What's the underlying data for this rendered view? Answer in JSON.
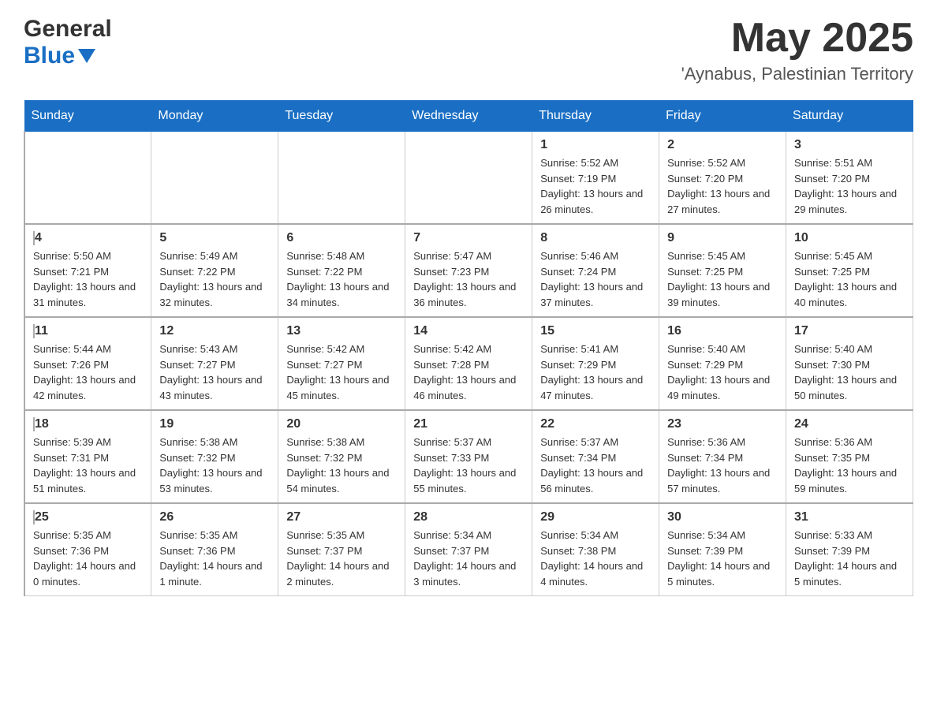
{
  "header": {
    "logo_top": "General",
    "logo_bottom": "Blue",
    "month": "May 2025",
    "location": "'Aynabus, Palestinian Territory"
  },
  "days_of_week": [
    "Sunday",
    "Monday",
    "Tuesday",
    "Wednesday",
    "Thursday",
    "Friday",
    "Saturday"
  ],
  "weeks": [
    [
      {
        "day": "",
        "info": ""
      },
      {
        "day": "",
        "info": ""
      },
      {
        "day": "",
        "info": ""
      },
      {
        "day": "",
        "info": ""
      },
      {
        "day": "1",
        "info": "Sunrise: 5:52 AM\nSunset: 7:19 PM\nDaylight: 13 hours and 26 minutes."
      },
      {
        "day": "2",
        "info": "Sunrise: 5:52 AM\nSunset: 7:20 PM\nDaylight: 13 hours and 27 minutes."
      },
      {
        "day": "3",
        "info": "Sunrise: 5:51 AM\nSunset: 7:20 PM\nDaylight: 13 hours and 29 minutes."
      }
    ],
    [
      {
        "day": "4",
        "info": "Sunrise: 5:50 AM\nSunset: 7:21 PM\nDaylight: 13 hours and 31 minutes."
      },
      {
        "day": "5",
        "info": "Sunrise: 5:49 AM\nSunset: 7:22 PM\nDaylight: 13 hours and 32 minutes."
      },
      {
        "day": "6",
        "info": "Sunrise: 5:48 AM\nSunset: 7:22 PM\nDaylight: 13 hours and 34 minutes."
      },
      {
        "day": "7",
        "info": "Sunrise: 5:47 AM\nSunset: 7:23 PM\nDaylight: 13 hours and 36 minutes."
      },
      {
        "day": "8",
        "info": "Sunrise: 5:46 AM\nSunset: 7:24 PM\nDaylight: 13 hours and 37 minutes."
      },
      {
        "day": "9",
        "info": "Sunrise: 5:45 AM\nSunset: 7:25 PM\nDaylight: 13 hours and 39 minutes."
      },
      {
        "day": "10",
        "info": "Sunrise: 5:45 AM\nSunset: 7:25 PM\nDaylight: 13 hours and 40 minutes."
      }
    ],
    [
      {
        "day": "11",
        "info": "Sunrise: 5:44 AM\nSunset: 7:26 PM\nDaylight: 13 hours and 42 minutes."
      },
      {
        "day": "12",
        "info": "Sunrise: 5:43 AM\nSunset: 7:27 PM\nDaylight: 13 hours and 43 minutes."
      },
      {
        "day": "13",
        "info": "Sunrise: 5:42 AM\nSunset: 7:27 PM\nDaylight: 13 hours and 45 minutes."
      },
      {
        "day": "14",
        "info": "Sunrise: 5:42 AM\nSunset: 7:28 PM\nDaylight: 13 hours and 46 minutes."
      },
      {
        "day": "15",
        "info": "Sunrise: 5:41 AM\nSunset: 7:29 PM\nDaylight: 13 hours and 47 minutes."
      },
      {
        "day": "16",
        "info": "Sunrise: 5:40 AM\nSunset: 7:29 PM\nDaylight: 13 hours and 49 minutes."
      },
      {
        "day": "17",
        "info": "Sunrise: 5:40 AM\nSunset: 7:30 PM\nDaylight: 13 hours and 50 minutes."
      }
    ],
    [
      {
        "day": "18",
        "info": "Sunrise: 5:39 AM\nSunset: 7:31 PM\nDaylight: 13 hours and 51 minutes."
      },
      {
        "day": "19",
        "info": "Sunrise: 5:38 AM\nSunset: 7:32 PM\nDaylight: 13 hours and 53 minutes."
      },
      {
        "day": "20",
        "info": "Sunrise: 5:38 AM\nSunset: 7:32 PM\nDaylight: 13 hours and 54 minutes."
      },
      {
        "day": "21",
        "info": "Sunrise: 5:37 AM\nSunset: 7:33 PM\nDaylight: 13 hours and 55 minutes."
      },
      {
        "day": "22",
        "info": "Sunrise: 5:37 AM\nSunset: 7:34 PM\nDaylight: 13 hours and 56 minutes."
      },
      {
        "day": "23",
        "info": "Sunrise: 5:36 AM\nSunset: 7:34 PM\nDaylight: 13 hours and 57 minutes."
      },
      {
        "day": "24",
        "info": "Sunrise: 5:36 AM\nSunset: 7:35 PM\nDaylight: 13 hours and 59 minutes."
      }
    ],
    [
      {
        "day": "25",
        "info": "Sunrise: 5:35 AM\nSunset: 7:36 PM\nDaylight: 14 hours and 0 minutes."
      },
      {
        "day": "26",
        "info": "Sunrise: 5:35 AM\nSunset: 7:36 PM\nDaylight: 14 hours and 1 minute."
      },
      {
        "day": "27",
        "info": "Sunrise: 5:35 AM\nSunset: 7:37 PM\nDaylight: 14 hours and 2 minutes."
      },
      {
        "day": "28",
        "info": "Sunrise: 5:34 AM\nSunset: 7:37 PM\nDaylight: 14 hours and 3 minutes."
      },
      {
        "day": "29",
        "info": "Sunrise: 5:34 AM\nSunset: 7:38 PM\nDaylight: 14 hours and 4 minutes."
      },
      {
        "day": "30",
        "info": "Sunrise: 5:34 AM\nSunset: 7:39 PM\nDaylight: 14 hours and 5 minutes."
      },
      {
        "day": "31",
        "info": "Sunrise: 5:33 AM\nSunset: 7:39 PM\nDaylight: 14 hours and 5 minutes."
      }
    ]
  ]
}
